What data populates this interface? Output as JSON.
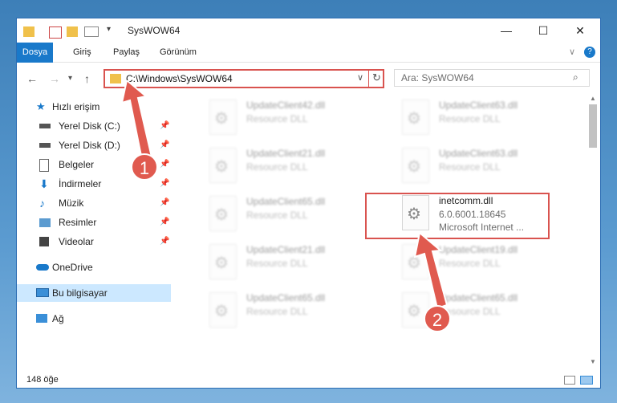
{
  "window": {
    "title": "SysWOW64",
    "controls": {
      "minimize": "—",
      "maximize": "☐",
      "close": "✕"
    }
  },
  "ribbon": {
    "tabs": [
      {
        "label": "Dosya",
        "active": true
      },
      {
        "label": "Giriş"
      },
      {
        "label": "Paylaş"
      },
      {
        "label": "Görünüm"
      }
    ],
    "help": "?"
  },
  "address": {
    "path": "C:\\Windows\\SysWOW64"
  },
  "search": {
    "placeholder": "Ara: SysWOW64"
  },
  "sidebar": {
    "items": [
      {
        "label": "Hızlı erişim",
        "icon": "star-icon"
      },
      {
        "label": "Yerel Disk (C:)",
        "icon": "drive-icon",
        "pinned": true
      },
      {
        "label": "Yerel Disk (D:)",
        "icon": "drive-icon",
        "pinned": true
      },
      {
        "label": "Belgeler",
        "icon": "documents-icon",
        "pinned": true
      },
      {
        "label": "İndirmeler",
        "icon": "download-icon",
        "pinned": true
      },
      {
        "label": "Müzik",
        "icon": "music-icon",
        "pinned": true
      },
      {
        "label": "Resimler",
        "icon": "pictures-icon",
        "pinned": true
      },
      {
        "label": "Videolar",
        "icon": "videos-icon",
        "pinned": true
      },
      {
        "label": "OneDrive",
        "icon": "cloud-icon"
      },
      {
        "label": "Bu bilgisayar",
        "icon": "computer-icon",
        "selected": true
      },
      {
        "label": "Ağ",
        "icon": "network-icon"
      }
    ]
  },
  "files": [
    {
      "name": "UpdateClient42.dll",
      "type": "Resource DLL"
    },
    {
      "name": "UpdateClient63.dll",
      "type": "Resource DLL"
    },
    {
      "name": "UpdateClient21.dll",
      "type": "Resource DLL"
    },
    {
      "name": "UpdateClient63.dll",
      "type": "Resource DLL"
    },
    {
      "name": "UpdateClient65.dll",
      "type": "Resource DLL"
    },
    {
      "name": "inetcomm.dll",
      "version": "6.0.6001.18645",
      "type": "Microsoft Internet ...",
      "highlighted": true
    },
    {
      "name": "UpdateClient21.dll",
      "type": "Resource DLL"
    },
    {
      "name": "UpdateClient19.dll",
      "type": "Resource DLL"
    },
    {
      "name": "UpdateClient65.dll",
      "type": "Resource DLL"
    },
    {
      "name": "UpdateClient65.dll",
      "type": "Resource DLL"
    }
  ],
  "status": {
    "count": "148 öğe"
  },
  "annotations": {
    "step1": "1",
    "step2": "2",
    "color": "#e05a4f"
  }
}
